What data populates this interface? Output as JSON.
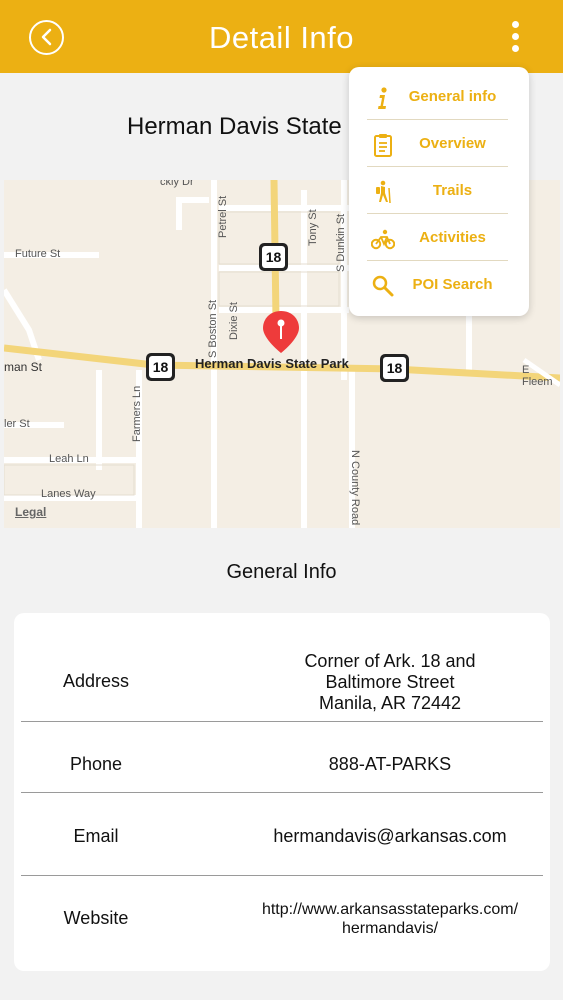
{
  "header": {
    "title": "Detail Info",
    "color": "#ecb013"
  },
  "park": {
    "title": "Herman Davis State Park"
  },
  "menu": {
    "items": [
      {
        "label": "General info",
        "icon": "info-icon"
      },
      {
        "label": "Overview",
        "icon": "clipboard-icon"
      },
      {
        "label": "Trails",
        "icon": "hiker-icon"
      },
      {
        "label": "Activities",
        "icon": "bicycle-icon"
      },
      {
        "label": "POI Search",
        "icon": "search-icon"
      }
    ]
  },
  "map": {
    "park_label": "Herman Davis State Park",
    "legal": "Legal",
    "route_number": "18",
    "streets": {
      "future": "Future St",
      "main": "man St",
      "east_fleet": "E Fleem",
      "petrel": "Petrel St",
      "tony": "Tony St",
      "dunkin": "S Dunkin St",
      "boston": "S Boston St",
      "dixie": "Dixie St",
      "farmers": "Farmers Ln",
      "county": "N County Road",
      "leah": "Leah Ln",
      "lanes": "Lanes Way",
      "ler": "ler St",
      "top": "ckly Dr"
    }
  },
  "general_info": {
    "title": "General Info",
    "rows": [
      {
        "label": "Address",
        "lines": [
          "Corner of Ark. 18 and",
          "Baltimore Street",
          "Manila, AR 72442"
        ]
      },
      {
        "label": "Phone",
        "lines": [
          "888-AT-PARKS"
        ]
      },
      {
        "label": "Email",
        "lines": [
          "hermandavis@arkansas.com"
        ]
      },
      {
        "label": "Website",
        "lines": [
          "http://www.arkansasstateparks.com/",
          "hermandavis/"
        ]
      }
    ]
  }
}
